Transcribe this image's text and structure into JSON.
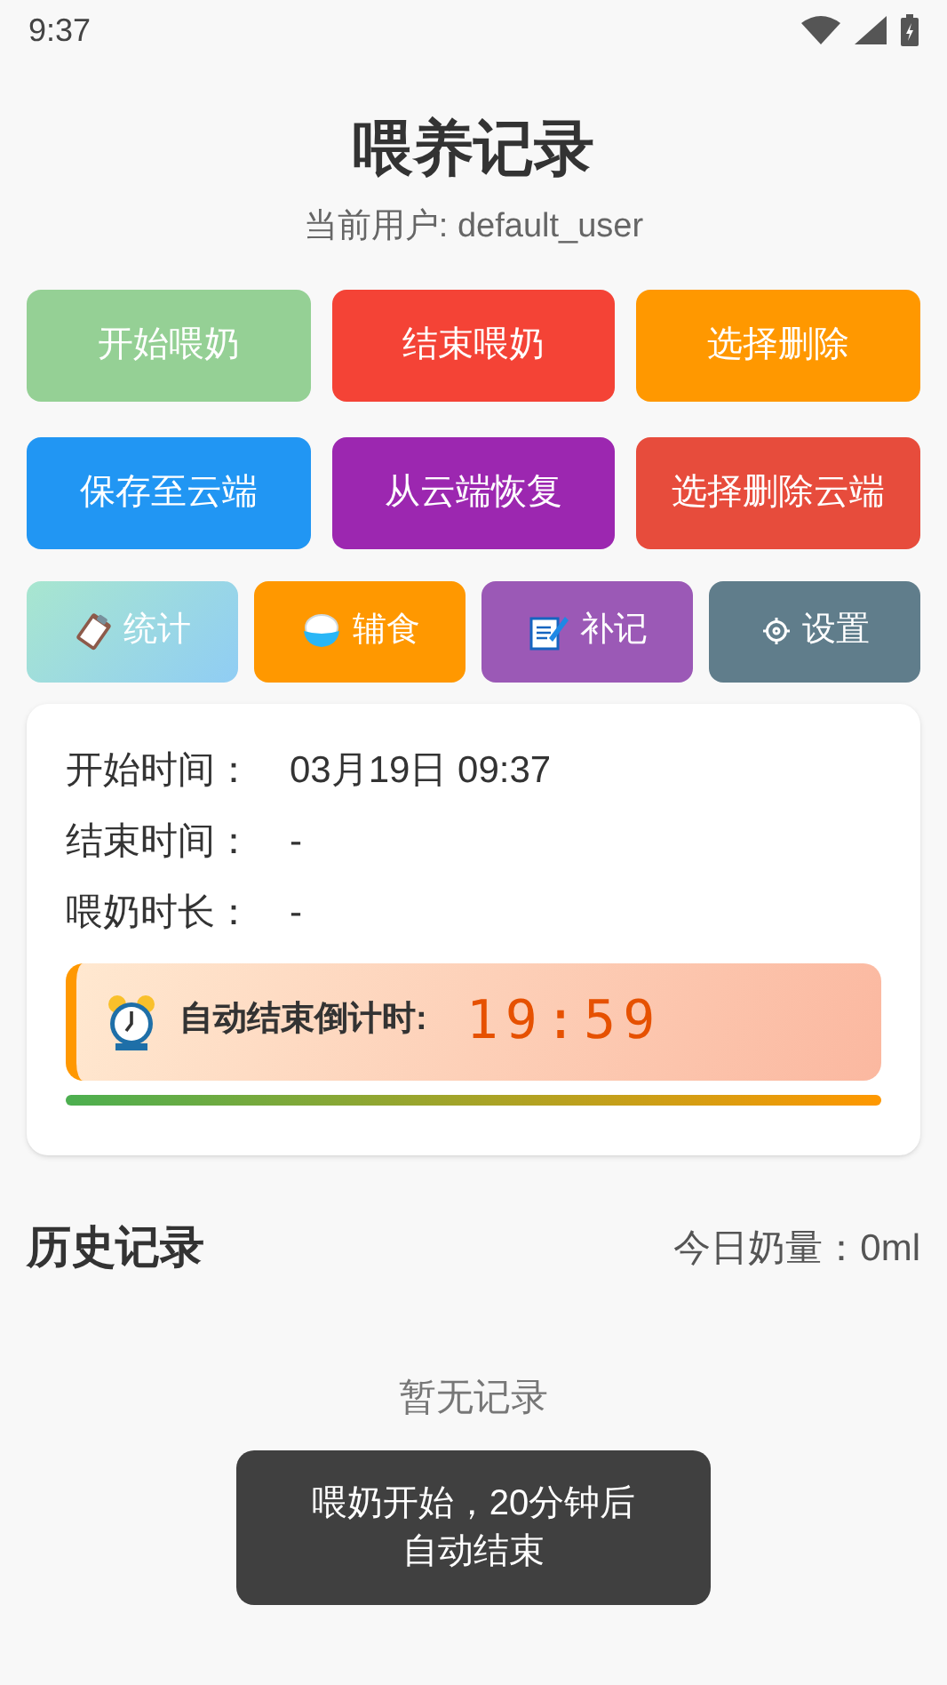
{
  "status_bar": {
    "time": "9:37"
  },
  "title": "喂养记录",
  "user_line": "当前用户: default_user",
  "action_buttons": [
    {
      "label": "开始喂奶",
      "color": "#95d095"
    },
    {
      "label": "结束喂奶",
      "color": "#f44336"
    },
    {
      "label": "选择删除",
      "color": "#ff9800"
    },
    {
      "label": "保存至云端",
      "color": "#2196f3"
    },
    {
      "label": "从云端恢复",
      "color": "#9c27b0"
    },
    {
      "label": "选择删除云端",
      "color": "#e74c3c"
    }
  ],
  "tool_buttons": [
    {
      "label": "统计",
      "kind": "clipboard",
      "color": "#90cdf4"
    },
    {
      "label": "辅食",
      "kind": "bowl",
      "color": "#ff9800"
    },
    {
      "label": "补记",
      "kind": "memo",
      "color": "#9b59b6"
    },
    {
      "label": "设置",
      "kind": "gear",
      "color": "#607d8b"
    }
  ],
  "session": {
    "fields": [
      {
        "label": "开始时间：",
        "value": "03月19日 09:37"
      },
      {
        "label": "结束时间：",
        "value": "-"
      },
      {
        "label": "喂奶时长：",
        "value": "-"
      }
    ],
    "countdown": {
      "label": "自动结束倒计时:",
      "time": "19:59",
      "level": 1
    }
  },
  "history": {
    "title": "历史记录",
    "today": "今日奶量：0ml",
    "empty": "暂无记录"
  },
  "toast": "喂奶开始，20分钟后自动结束"
}
